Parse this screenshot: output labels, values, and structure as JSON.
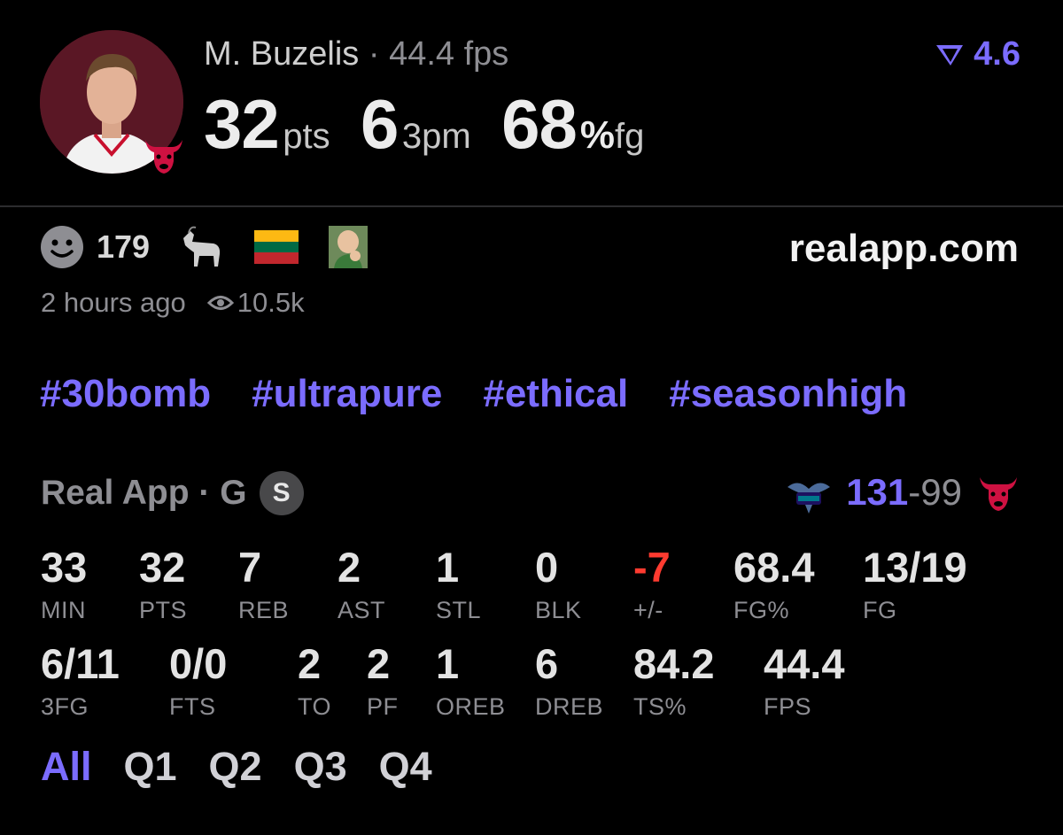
{
  "player": {
    "name": "M. Buzelis",
    "separator": "·",
    "fps": "44.4 fps"
  },
  "headline": {
    "points": "32",
    "points_unit": "pts",
    "threes": "6",
    "threes_unit": "3pm",
    "fg_pct": "68",
    "pct_sign": "%",
    "fg_unit": "fg"
  },
  "rating": "4.6",
  "reactions": {
    "count": "179"
  },
  "site": "realapp.com",
  "meta": {
    "time_ago": "2 hours ago",
    "views": "10.5k"
  },
  "hashtags": [
    "#30bomb",
    "#ultrapure",
    "#ethical",
    "#seasonhigh"
  ],
  "source": {
    "label": "Real App · G",
    "badge": "S"
  },
  "score": {
    "home": "131",
    "sep": "-",
    "away": "99"
  },
  "stats_row1": [
    {
      "value": "33",
      "label": "MIN"
    },
    {
      "value": "32",
      "label": "PTS"
    },
    {
      "value": "7",
      "label": "REB"
    },
    {
      "value": "2",
      "label": "AST"
    },
    {
      "value": "1",
      "label": "STL"
    },
    {
      "value": "0",
      "label": "BLK"
    },
    {
      "value": "-7",
      "label": "+/-"
    },
    {
      "value": "68.4",
      "label": "FG%"
    },
    {
      "value": "13/19",
      "label": "FG"
    }
  ],
  "stats_row2": [
    {
      "value": "6/11",
      "label": "3FG"
    },
    {
      "value": "0/0",
      "label": "FTS"
    },
    {
      "value": "2",
      "label": "TO"
    },
    {
      "value": "2",
      "label": "PF"
    },
    {
      "value": "1",
      "label": "OREB"
    },
    {
      "value": "6",
      "label": "DREB"
    },
    {
      "value": "84.2",
      "label": "TS%"
    },
    {
      "value": "44.4",
      "label": "FPS"
    }
  ],
  "quarter_tabs": [
    "All",
    "Q1",
    "Q2",
    "Q3",
    "Q4"
  ],
  "colors": {
    "accent": "#7b6cff",
    "negative": "#ff3b30",
    "muted": "#8e8e93",
    "team": "#ce1141"
  },
  "icons": {
    "reaction": "smiley-icon",
    "goat": "goat-emoji",
    "flag": "lithuania-flag-emoji",
    "success_kid": "success-kid-emoji",
    "views": "eye-icon",
    "rating": "real-logo-icon",
    "home_team": "hornets-logo",
    "away_team": "bulls-logo"
  }
}
